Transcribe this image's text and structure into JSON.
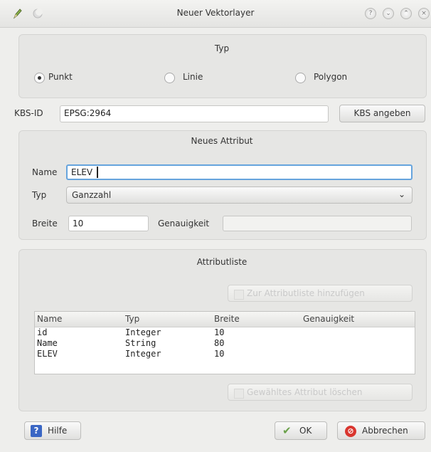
{
  "window": {
    "title": "Neuer Vektorlayer"
  },
  "typ": {
    "heading": "Typ",
    "options": [
      {
        "label": "Punkt",
        "checked": true
      },
      {
        "label": "Linie",
        "checked": false
      },
      {
        "label": "Polygon",
        "checked": false
      }
    ]
  },
  "kbs": {
    "label": "KBS-ID",
    "value": "EPSG:2964",
    "button": "KBS angeben"
  },
  "new_attribute": {
    "heading": "Neues Attribut",
    "name_label": "Name",
    "name_value": "ELEV",
    "type_label": "Typ",
    "type_value": "Ganzzahl",
    "width_label": "Breite",
    "width_value": "10",
    "precision_label": "Genauigkeit",
    "precision_value": ""
  },
  "attribute_list": {
    "heading": "Attributliste",
    "add_button": "Zur Attributliste hinzufügen",
    "delete_button": "Gewähltes Attribut löschen",
    "columns": [
      "Name",
      "Typ",
      "Breite",
      "Genauigkeit"
    ],
    "rows": [
      {
        "name": "id",
        "type": "Integer",
        "width": "10",
        "precision": ""
      },
      {
        "name": "Name",
        "type": "String",
        "width": "80",
        "precision": ""
      },
      {
        "name": "ELEV",
        "type": "Integer",
        "width": "10",
        "precision": ""
      }
    ]
  },
  "footer": {
    "help": "Hilfe",
    "ok": "OK",
    "cancel": "Abbrechen"
  },
  "colors": {
    "focus": "#66a4dd",
    "window_bg": "#eeeeec",
    "cancel_red": "#d9362f",
    "ok_green": "#6aa14a",
    "help_blue": "#3a66c4"
  },
  "icons": [
    "pen-icon",
    "moon-icon",
    "help-icon",
    "minimize-icon",
    "maximize-icon",
    "close-icon",
    "chevron-down-icon",
    "checkmark-icon",
    "cancel-icon",
    "help-book-icon"
  ]
}
